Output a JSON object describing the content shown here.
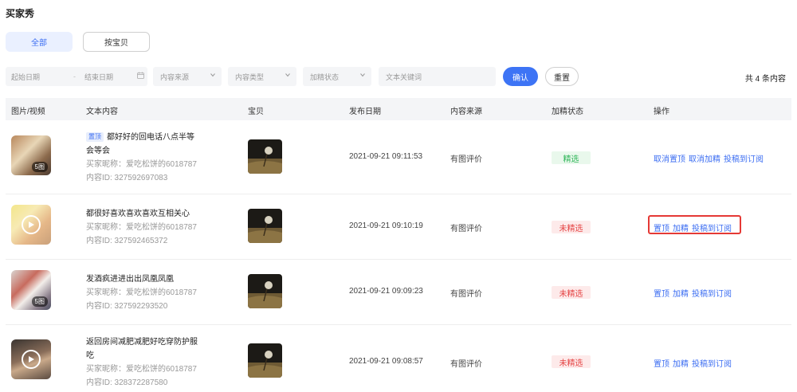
{
  "page": {
    "title": "买家秀"
  },
  "segments": {
    "all": "全部",
    "by_item": "按宝贝"
  },
  "filters": {
    "start_date": "起始日期",
    "date_sep": "-",
    "end_date": "结束日期",
    "content_source": "内容来源",
    "content_type": "内容类型",
    "featured_status": "加精状态",
    "keyword_placeholder": "文本关键词",
    "confirm": "确认",
    "reset": "重置",
    "total": "共 4 条内容"
  },
  "table": {
    "headers": [
      "图片/视频",
      "文本内容",
      "宝贝",
      "发布日期",
      "内容来源",
      "加精状态",
      "操作"
    ],
    "rows": [
      {
        "media_badge": "5图",
        "media_type": "image",
        "top_tag": "置顶",
        "text_line1": "都好好的回电话八点半等",
        "text_line2": "会等会",
        "nickname": "买家昵称：爱吃松饼的6018787",
        "content_id": "内容ID: 327592697083",
        "date": "2021-09-21 09:11:53",
        "source": "有图评价",
        "status": "精选",
        "status_type": "selected",
        "ops": [
          "取消置顶",
          "取消加精",
          "投稿到订阅"
        ]
      },
      {
        "media_badge": "",
        "media_type": "video",
        "top_tag": "",
        "text_line1": "都很好喜欢喜欢喜欢互相关心",
        "text_line2": "",
        "nickname": "买家昵称：爱吃松饼的6018787",
        "content_id": "内容ID: 327592465372",
        "date": "2021-09-21 09:10:19",
        "source": "有图评价",
        "status": "未精选",
        "status_type": "unselected",
        "ops": [
          "置顶",
          "加精",
          "投稿到订阅"
        ]
      },
      {
        "media_badge": "5图",
        "media_type": "image",
        "top_tag": "",
        "text_line1": "发酒疯进进出出凤凰凤凰",
        "text_line2": "",
        "nickname": "买家昵称：爱吃松饼的6018787",
        "content_id": "内容ID: 327592293520",
        "date": "2021-09-21 09:09:23",
        "source": "有图评价",
        "status": "未精选",
        "status_type": "unselected",
        "ops": [
          "置顶",
          "加精",
          "投稿到订阅"
        ]
      },
      {
        "media_badge": "",
        "media_type": "video",
        "top_tag": "",
        "text_line1": "返回房间减肥减肥好吃穿防护服",
        "text_line2": "吃",
        "nickname": "买家昵称：爱吃松饼的6018787",
        "content_id": "内容ID: 328372287580",
        "date": "2021-09-21 09:08:57",
        "source": "有图评价",
        "status": "未精选",
        "status_type": "unselected",
        "ops": [
          "置顶",
          "加精",
          "投稿到订阅"
        ]
      }
    ]
  },
  "colors": {
    "accent": "#3d74f5",
    "selected": "#2fb558",
    "unselected": "#e54545",
    "highlight": "#e53935"
  },
  "icons": [
    "chevron-down-icon",
    "calendar-icon",
    "play-icon"
  ]
}
